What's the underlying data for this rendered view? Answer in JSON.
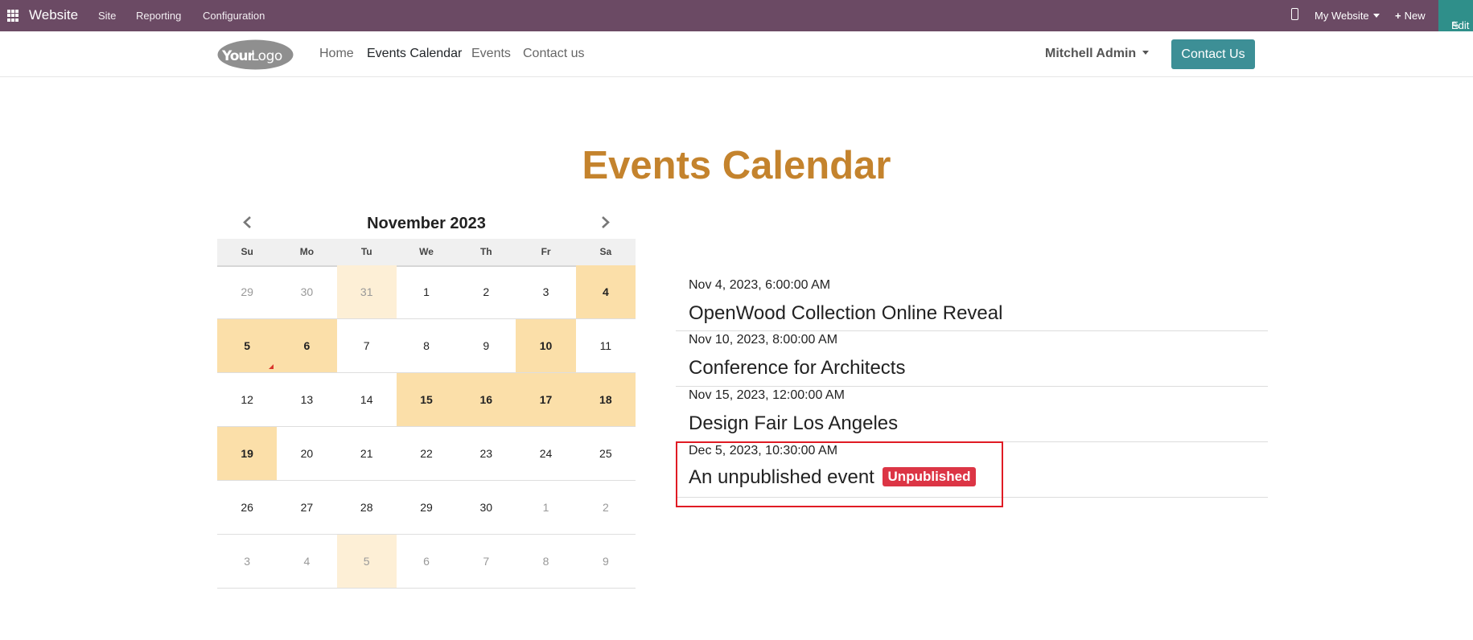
{
  "topbar": {
    "app_name": "Website",
    "menu": [
      "Site",
      "Reporting",
      "Configuration"
    ],
    "website_selector": "My Website",
    "new_label": "New",
    "edit_label": "Edit",
    "color": "#6b4a64"
  },
  "navbar": {
    "logo_text_bold": "Your",
    "logo_text": "Logo",
    "links": [
      "Home",
      "Events Calendar",
      "Events",
      "Contact us"
    ],
    "active_link": "Events Calendar",
    "user": "Mitchell Admin",
    "contact_button": "Contact Us",
    "accent": "#3d8f96"
  },
  "page": {
    "title": "Events Calendar",
    "title_color": "#c4832d"
  },
  "calendar": {
    "month_label": "November 2023",
    "weekdays": [
      "Su",
      "Mo",
      "Tu",
      "We",
      "Th",
      "Fr",
      "Sa"
    ],
    "weeks": [
      [
        "29",
        "30",
        "31",
        "1",
        "2",
        "3",
        "4"
      ],
      [
        "5",
        "6",
        "7",
        "8",
        "9",
        "10",
        "11"
      ],
      [
        "12",
        "13",
        "14",
        "15",
        "16",
        "17",
        "18"
      ],
      [
        "19",
        "20",
        "21",
        "22",
        "23",
        "24",
        "25"
      ],
      [
        "26",
        "27",
        "28",
        "29",
        "30",
        "1",
        "2"
      ],
      [
        "3",
        "4",
        "5",
        "6",
        "7",
        "8",
        "9"
      ]
    ],
    "event_color": "#fbdfa9",
    "light_color": "#fdefd6"
  },
  "events": [
    {
      "date": "Nov 4, 2023, 6:00:00 AM",
      "title": "OpenWood Collection Online Reveal"
    },
    {
      "date": "Nov 10, 2023, 8:00:00 AM",
      "title": "Conference for Architects"
    },
    {
      "date": "Nov 15, 2023, 12:00:00 AM",
      "title": "Design Fair Los Angeles"
    },
    {
      "date": "Dec 5, 2023, 10:30:00 AM",
      "title": "An unpublished event",
      "badge": "Unpublished"
    }
  ]
}
